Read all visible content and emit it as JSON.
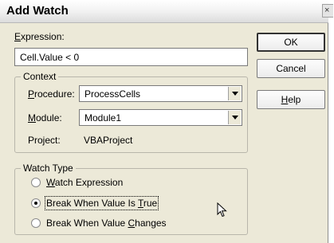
{
  "window": {
    "title": "Add Watch",
    "close_glyph": "×"
  },
  "expression": {
    "label_prefix": "",
    "label_hotkey": "E",
    "label_rest": "xpression:",
    "value": "Cell.Value < 0"
  },
  "buttons": {
    "ok": "OK",
    "cancel": "Cancel",
    "help_hotkey": "H",
    "help_rest": "elp"
  },
  "context": {
    "legend": "Context",
    "procedure": {
      "label_hotkey": "P",
      "label_rest": "rocedure:",
      "value": "ProcessCells"
    },
    "module": {
      "label_hotkey": "M",
      "label_rest": "odule:",
      "value": "Module1"
    },
    "project": {
      "label": "Project:",
      "value": "VBAProject"
    }
  },
  "watch_type": {
    "legend": "Watch Type",
    "options": [
      {
        "hotkey": "W",
        "before": "",
        "after": "atch Expression",
        "checked": false
      },
      {
        "hotkey": "T",
        "before": "Break When Value Is ",
        "after": "rue",
        "checked": true
      },
      {
        "hotkey": "C",
        "before": "Break When Value ",
        "after": "hanges",
        "checked": false
      }
    ]
  },
  "icons": {
    "cursor": "mouse-pointer-icon",
    "radio": "radio-button-icon",
    "dropdown": "chevron-down-icon"
  }
}
